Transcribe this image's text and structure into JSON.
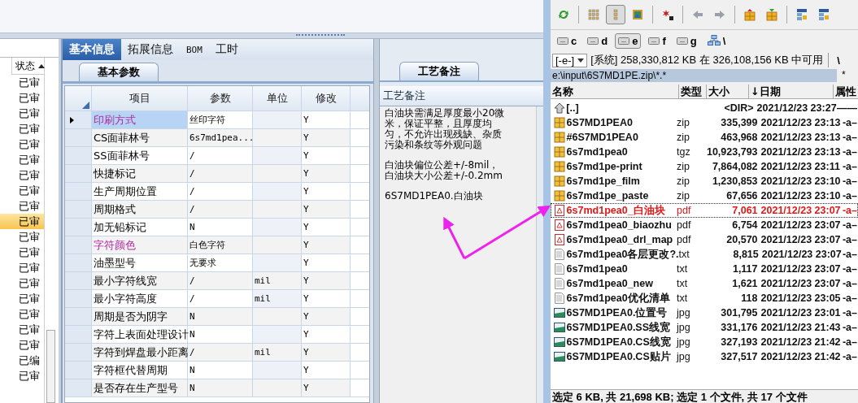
{
  "left_list": {
    "column": "状态",
    "rows": [
      {
        "text": "已审",
        "selected": false
      },
      {
        "text": "已审",
        "selected": false
      },
      {
        "text": "已审",
        "selected": false
      },
      {
        "text": "已审",
        "selected": false
      },
      {
        "text": "已审",
        "selected": false
      },
      {
        "text": "已审",
        "selected": false
      },
      {
        "text": "已审",
        "selected": false
      },
      {
        "text": "已审",
        "selected": false
      },
      {
        "text": "已审",
        "selected": false
      },
      {
        "text": "已审",
        "selected": true
      },
      {
        "text": "已审",
        "selected": false
      },
      {
        "text": "已审",
        "selected": false
      },
      {
        "text": "已审",
        "selected": false
      },
      {
        "text": "已审",
        "selected": false
      },
      {
        "text": "已审",
        "selected": false
      },
      {
        "text": "已审",
        "selected": false
      },
      {
        "text": "已审",
        "selected": false
      },
      {
        "text": "已审",
        "selected": false
      },
      {
        "text": "已编",
        "selected": false
      },
      {
        "text": "已审",
        "selected": false
      }
    ]
  },
  "tabs": [
    {
      "label": "基本信息",
      "selected": true
    },
    {
      "label": "拓展信息",
      "selected": false
    },
    {
      "label": "BOM",
      "selected": false
    },
    {
      "label": "工时",
      "selected": false
    }
  ],
  "subtab": "基本参数",
  "grid": {
    "columns": [
      "项目",
      "参数",
      "单位",
      "修改"
    ],
    "rows": [
      {
        "item": "印刷方式",
        "param": "丝印字符",
        "edit": "Y",
        "emphasized": true,
        "selected": true
      },
      {
        "item": "CS面菲林号",
        "param": "6s7md1pea...",
        "edit": "Y",
        "emphasized": false,
        "selected": false
      },
      {
        "item": "SS面菲林号",
        "param": "/",
        "edit": "Y",
        "emphasized": false,
        "selected": false
      },
      {
        "item": "快捷标记",
        "param": "/",
        "edit": "Y",
        "emphasized": false,
        "selected": false
      },
      {
        "item": "生产周期位置",
        "param": "/",
        "edit": "Y",
        "emphasized": false,
        "selected": false
      },
      {
        "item": "周期格式",
        "param": "/",
        "edit": "Y",
        "emphasized": false,
        "selected": false
      },
      {
        "item": "加无铅标记",
        "param": "N",
        "edit": "Y",
        "emphasized": false,
        "selected": false
      },
      {
        "item": "字符颜色",
        "param": "白色字符",
        "edit": "Y",
        "emphasized": true,
        "selected": false
      },
      {
        "item": "油墨型号",
        "param": "无要求",
        "edit": "Y",
        "emphasized": false,
        "selected": false
      },
      {
        "item": "最小字符线宽",
        "param": "/",
        "unit": "mil",
        "edit": "Y",
        "emphasized": false,
        "selected": false
      },
      {
        "item": "最小字符高度",
        "param": "/",
        "unit": "mil",
        "edit": "Y",
        "emphasized": false,
        "selected": false
      },
      {
        "item": "周期是否为阴字",
        "param": "N",
        "edit": "Y",
        "emphasized": false,
        "selected": false
      },
      {
        "item": "字符上表面处理设计",
        "param": "N",
        "edit": "Y",
        "emphasized": false,
        "selected": false
      },
      {
        "item": "字符到焊盘最小距离",
        "param": "/",
        "unit": "mil",
        "edit": "Y",
        "emphasized": false,
        "selected": false
      },
      {
        "item": "字符框代替周期",
        "param": "N",
        "edit": "Y",
        "emphasized": false,
        "selected": false
      },
      {
        "item": "是否存在生产型号",
        "param": "N",
        "edit": "Y",
        "emphasized": false,
        "selected": false
      }
    ]
  },
  "notes": {
    "tab": "工艺备注",
    "header": "工艺备注",
    "paragraphs": [
      "白油块需满足厚度最小20微米，保证平整，且厚度均匀，不允许出现残缺、杂质污染和条纹等外观问题",
      "白油块偏位公差+/-8mil，白油块大小公差+/-0.2mm",
      "6S7MD1PEA0.白油块"
    ]
  },
  "file_manager": {
    "toolbar": [
      {
        "kind": "refresh",
        "pressed": false
      },
      {
        "kind": "sep"
      },
      {
        "kind": "icons",
        "pressed": false
      },
      {
        "kind": "list",
        "pressed": true
      },
      {
        "kind": "image",
        "pressed": false
      },
      {
        "kind": "sep"
      },
      {
        "kind": "star",
        "pressed": false
      },
      {
        "kind": "sep"
      },
      {
        "kind": "back",
        "pressed": false
      },
      {
        "kind": "forward",
        "pressed": false
      },
      {
        "kind": "sep"
      },
      {
        "kind": "pack",
        "pressed": false
      },
      {
        "kind": "unpack",
        "pressed": false
      },
      {
        "kind": "sep"
      },
      {
        "kind": "ftp",
        "pressed": false
      },
      {
        "kind": "url",
        "pressed": false
      }
    ],
    "drives": [
      {
        "label": "c",
        "selected": false
      },
      {
        "label": "d",
        "selected": false
      },
      {
        "label": "e",
        "selected": true
      },
      {
        "label": "f",
        "selected": false
      },
      {
        "label": "g",
        "selected": false
      }
    ],
    "network": "\\",
    "drive_select": "[-e-]",
    "free_space": "[系统] 258,330,812 KB 在 326,108,156 KB 中可用",
    "root_button": "\\",
    "path": "e:\\input\\6S7MD1PE.zip\\*.*",
    "filter": "*",
    "columns": [
      "名称",
      "类型",
      "大小",
      "↓日期",
      "属性"
    ],
    "files": [
      {
        "kind": "up",
        "name": "[..]",
        "size": "<DIR>",
        "date": "2021/12/23 23:27",
        "attr": "——",
        "selected": false
      },
      {
        "kind": "archive",
        "name": "6S7MD1PEA0",
        "type": "zip",
        "size": "335,399",
        "date": "2021/12/23 23:13",
        "attr": "-a–",
        "selected": false
      },
      {
        "kind": "archive",
        "name": "#6S7MD1PEA0",
        "type": "zip",
        "size": "463,968",
        "date": "2021/12/23 23:13",
        "attr": "-a–",
        "selected": false
      },
      {
        "kind": "archive",
        "name": "6s7md1pea0",
        "type": "tgz",
        "size": "10,923,793",
        "date": "2021/12/23 23:13",
        "attr": "-a–",
        "selected": false
      },
      {
        "kind": "archive",
        "name": "6s7md1pe-print",
        "type": "zip",
        "size": "7,864,082",
        "date": "2021/12/23 23:11",
        "attr": "-a–",
        "selected": false
      },
      {
        "kind": "archive",
        "name": "6s7md1pe_film",
        "type": "zip",
        "size": "1,230,853",
        "date": "2021/12/23 23:10",
        "attr": "-a–",
        "selected": false
      },
      {
        "kind": "archive",
        "name": "6s7md1pe_paste",
        "type": "zip",
        "size": "67,656",
        "date": "2021/12/23 23:10",
        "attr": "-a–",
        "selected": false
      },
      {
        "kind": "pdf",
        "name": "6s7md1pea0_白油块",
        "type": "pdf",
        "size": "7,061",
        "date": "2021/12/23 23:07",
        "attr": "-a–",
        "selected": true
      },
      {
        "kind": "pdf",
        "name": "6s7md1pea0_biaozhu",
        "type": "pdf",
        "size": "6,754",
        "date": "2021/12/23 23:07",
        "attr": "-a–",
        "selected": false
      },
      {
        "kind": "pdf",
        "name": "6s7md1pea0_drl_map",
        "type": "pdf",
        "size": "20,570",
        "date": "2021/12/23 23:07",
        "attr": "-a–",
        "selected": false
      },
      {
        "kind": "text",
        "name": "6s7md1pea0各层更改?.",
        "type": "txt",
        "size": "8,815",
        "date": "2021/12/23 23:07",
        "attr": "-a–",
        "selected": false
      },
      {
        "kind": "text",
        "name": "6s7md1pea0",
        "type": "txt",
        "size": "1,117",
        "date": "2021/12/23 23:07",
        "attr": "-a–",
        "selected": false
      },
      {
        "kind": "text",
        "name": "6s7md1pea0_new",
        "type": "txt",
        "size": "1,621",
        "date": "2021/12/23 23:07",
        "attr": "-a–",
        "selected": false
      },
      {
        "kind": "text",
        "name": "6s7md1pea0优化清单",
        "type": "txt",
        "size": "118",
        "date": "2021/12/23 23:05",
        "attr": "-a–",
        "selected": false
      },
      {
        "kind": "image",
        "name": "6S7MD1PEA0.位置号",
        "type": "jpg",
        "size": "301,795",
        "date": "2021/12/23 23:01",
        "attr": "-a–",
        "selected": false
      },
      {
        "kind": "image",
        "name": "6S7MD1PEA0.SS线宽",
        "type": "jpg",
        "size": "331,176",
        "date": "2021/12/23 21:43",
        "attr": "-a–",
        "selected": false
      },
      {
        "kind": "image",
        "name": "6S7MD1PEA0.CS线宽",
        "type": "jpg",
        "size": "327,193",
        "date": "2021/12/23 21:42",
        "attr": "-a–",
        "selected": false
      },
      {
        "kind": "image",
        "name": "6S7MD1PEA0.CS贴片",
        "type": "jpg",
        "size": "327,517",
        "date": "2021/12/23 21:42",
        "attr": "-a–",
        "selected": false
      }
    ],
    "status_bar": "选定 6 KB, 共 21,698 KB; 选定 1 个文件, 共 17 个文件"
  }
}
